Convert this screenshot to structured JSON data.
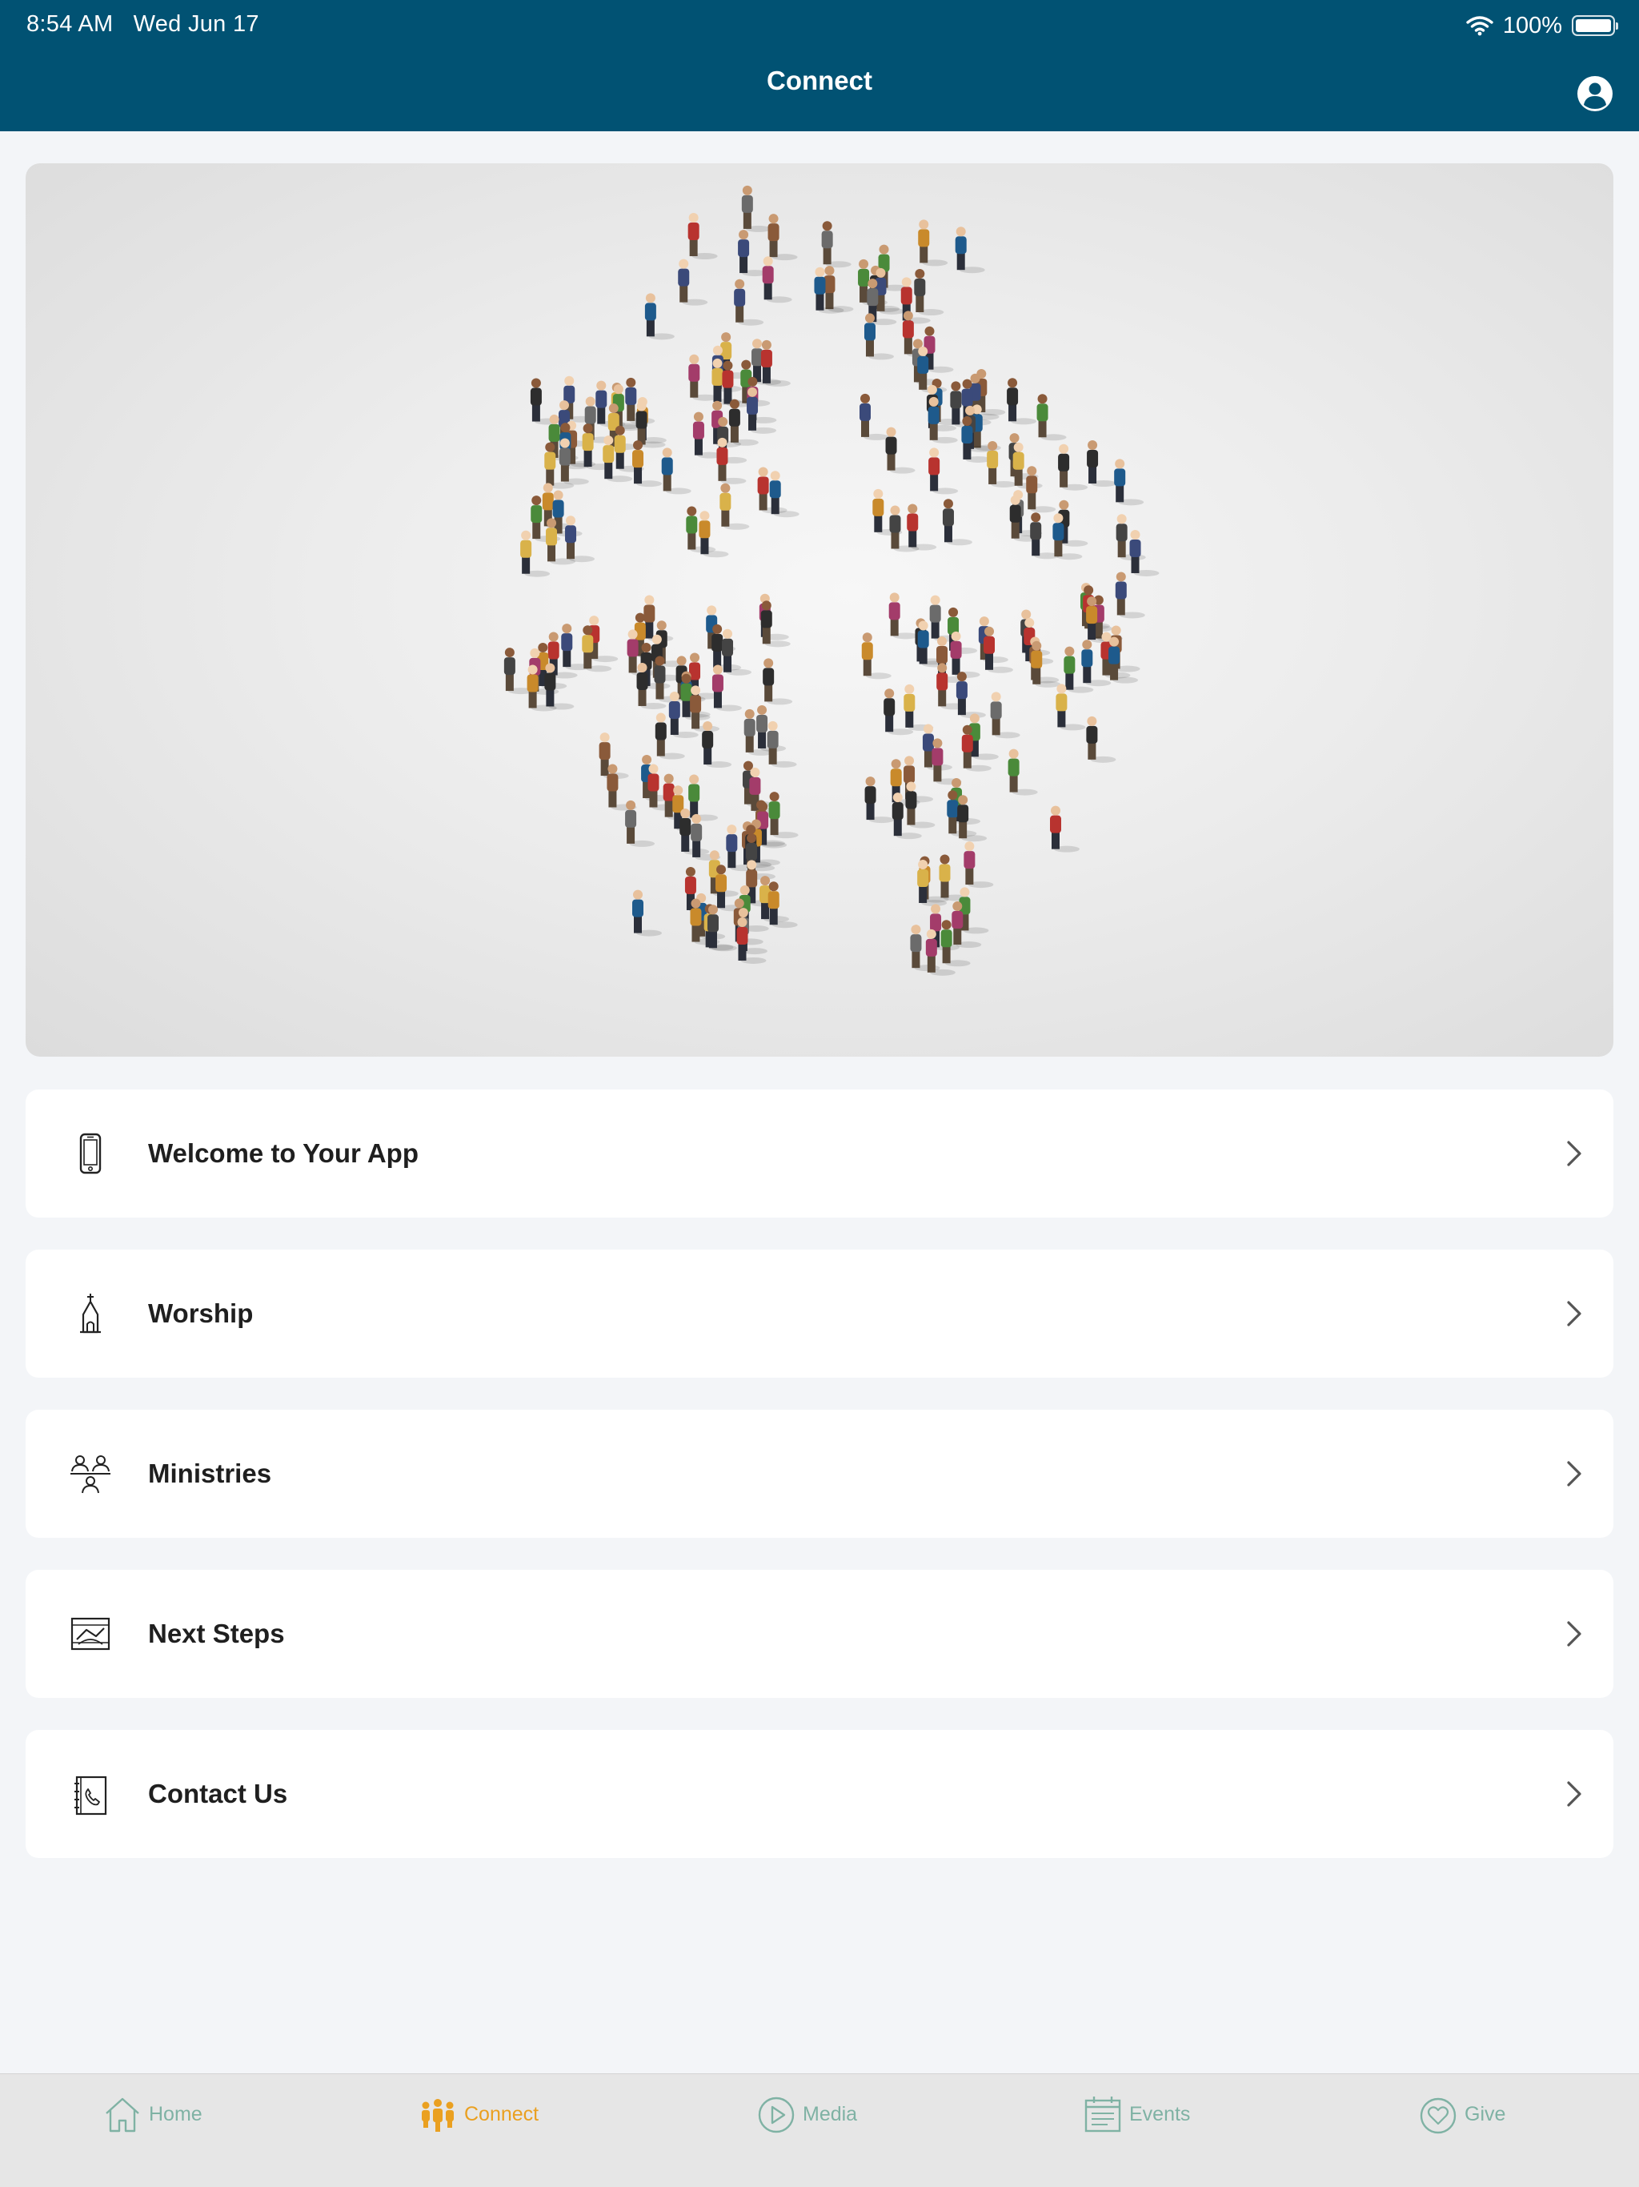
{
  "status_bar": {
    "time": "8:54 AM",
    "date": "Wed Jun 17",
    "battery": "100%",
    "battery_level": 1.0
  },
  "header": {
    "title": "Connect",
    "profile_icon": "person-circle-icon"
  },
  "hero": {
    "image": "crowd-forming-cross"
  },
  "menu": [
    {
      "label": "Welcome to Your App",
      "icon": "smartphone-icon"
    },
    {
      "label": "Worship",
      "icon": "church-icon"
    },
    {
      "label": "Ministries",
      "icon": "people-group-icon"
    },
    {
      "label": "Next Steps",
      "icon": "steps-icon"
    },
    {
      "label": "Contact Us",
      "icon": "phone-book-icon"
    }
  ],
  "tabbar": {
    "active_color": "#eaa020",
    "inactive_color": "#7fb2a4",
    "tabs": [
      {
        "label": "Home",
        "icon": "home-icon",
        "active": false
      },
      {
        "label": "Connect",
        "icon": "people-icon",
        "active": true
      },
      {
        "label": "Media",
        "icon": "play-icon",
        "active": false
      },
      {
        "label": "Events",
        "icon": "calendar-icon",
        "active": false
      },
      {
        "label": "Give",
        "icon": "heart-icon",
        "active": false
      }
    ]
  }
}
